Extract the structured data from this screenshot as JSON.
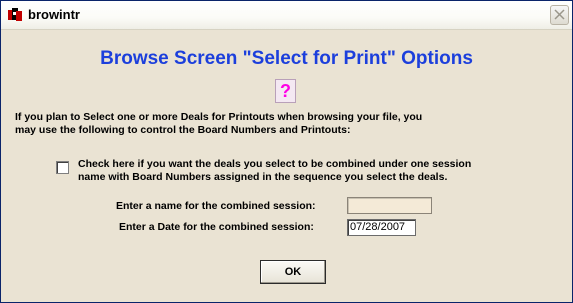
{
  "window": {
    "title": "browintr",
    "close_symbol": "close-icon",
    "accent_color": "#1c3fdc",
    "help_color": "#ff00e6"
  },
  "dialog": {
    "heading": "Browse Screen \"Select for Print\" Options",
    "help_glyph": "?",
    "intro_line1": "If you plan to Select one or more Deals for Printouts when browsing your file, you",
    "intro_line2": "may use the following to control the Board Numbers and Printouts:",
    "combine_checkbox": {
      "checked": false,
      "label_line1": "Check here if you want the deals you select to be combined under one session",
      "label_line2": "name with Board Numbers assigned in the sequence you select the deals."
    },
    "session_name": {
      "label": "Enter a name for the combined session:",
      "value": ""
    },
    "session_date": {
      "label": "Enter a Date for the combined session:",
      "value": "07/28/2007"
    },
    "ok_label": "OK"
  }
}
